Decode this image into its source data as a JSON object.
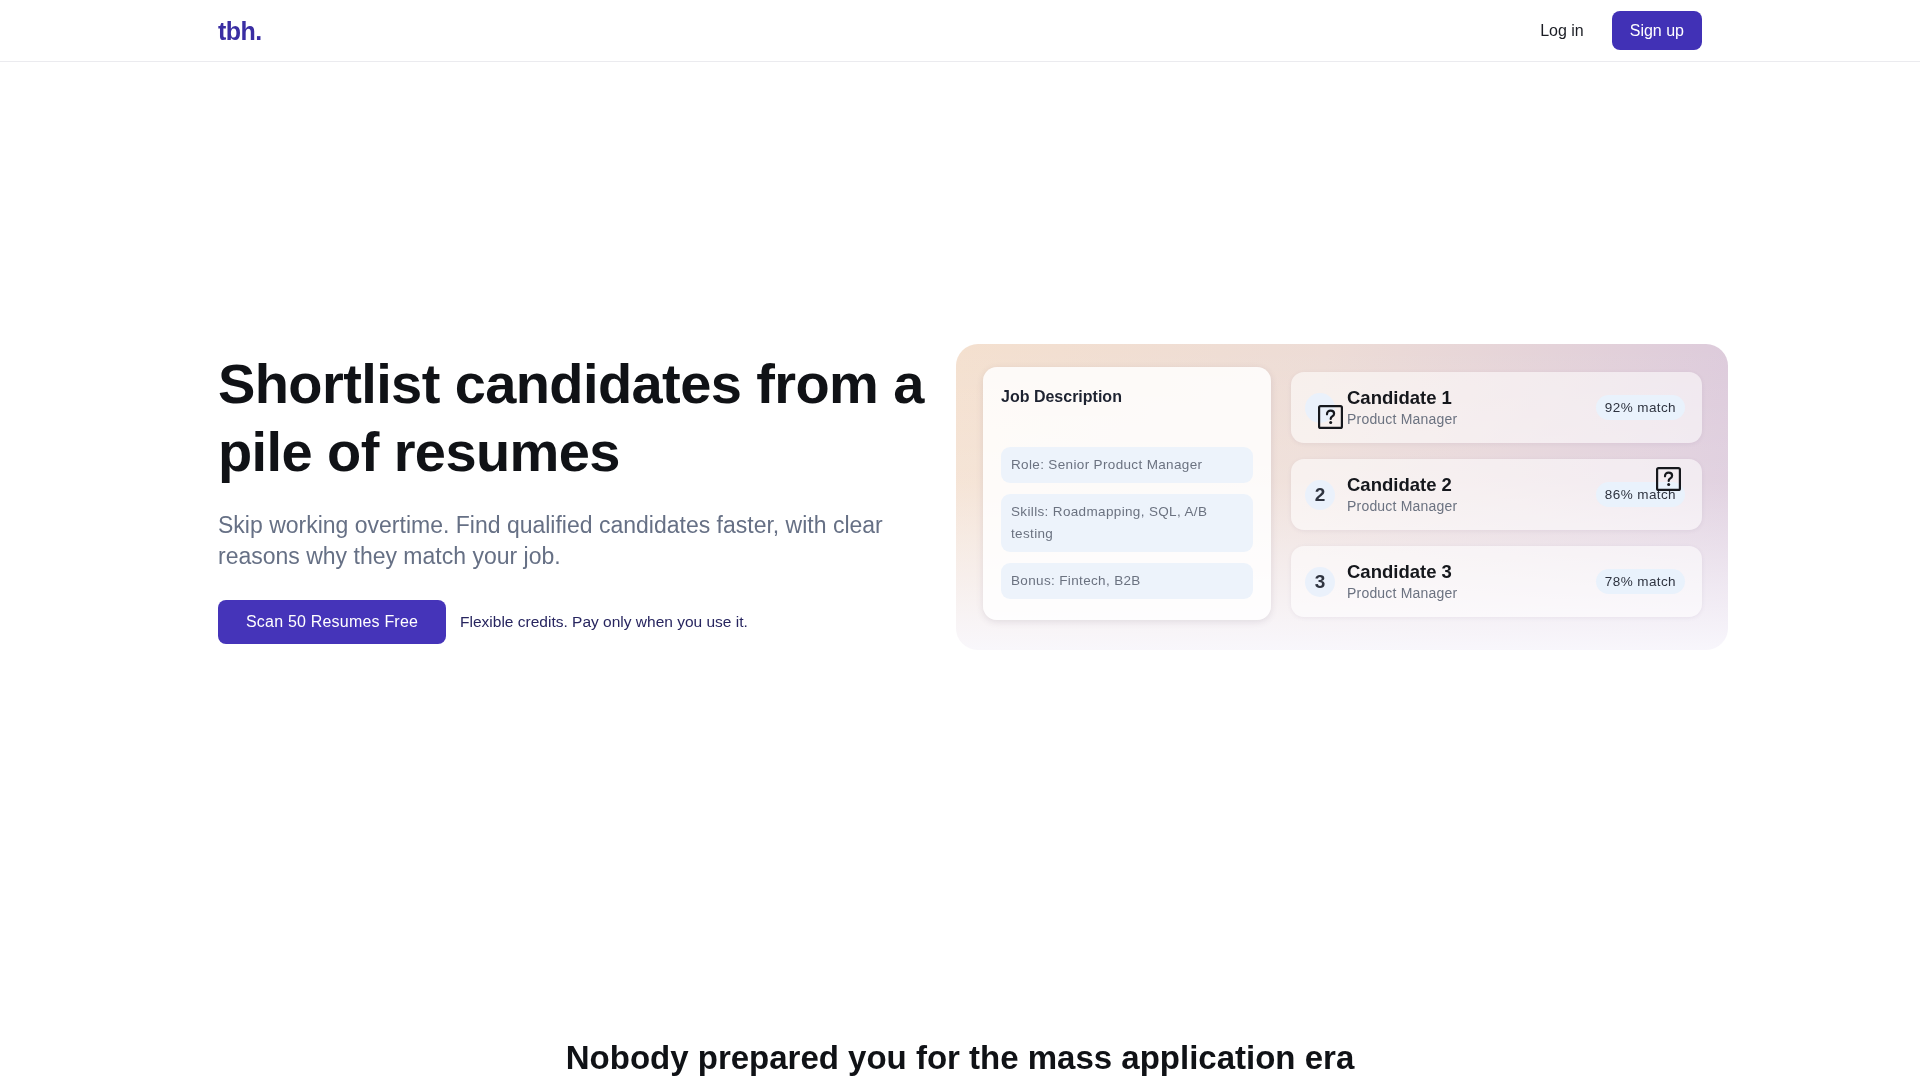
{
  "header": {
    "logo": "tbh.",
    "login": {
      "label": "Log in"
    },
    "signup": {
      "label": "Sign up"
    }
  },
  "hero": {
    "title": "Shortlist candidates from a pile of resumes",
    "subtitle": "Skip working overtime. Find qualified candidates faster, with clear reasons why they match your job.",
    "cta": {
      "label": "Scan 50 Resumes Free"
    },
    "note": "Flexible credits. Pay only when you use it."
  },
  "showcase": {
    "job_description": {
      "title": "Job Description",
      "items": [
        "Role: Senior Product Manager",
        "Skills: Roadmapping, SQL, A/B testing",
        "Bonus: Fintech, B2B"
      ]
    },
    "candidates": [
      {
        "name": "Candidate 1",
        "role": "Product Manager",
        "match": "92% match"
      },
      {
        "rank": "2",
        "name": "Candidate 2",
        "role": "Product Manager",
        "match": "86% match"
      },
      {
        "rank": "3",
        "name": "Candidate 3",
        "role": "Product Manager",
        "match": "78% match"
      }
    ]
  },
  "section": {
    "title": "Nobody prepared you for the mass application era"
  }
}
